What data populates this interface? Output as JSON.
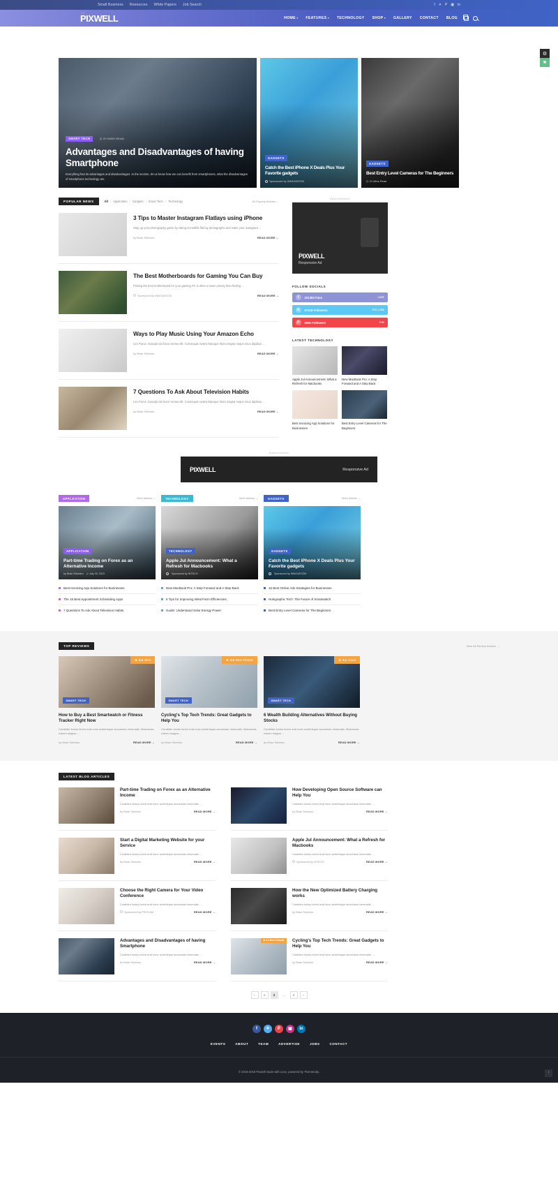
{
  "topbar": {
    "links": [
      "Small Business",
      "Resources",
      "White Papers",
      "Job Search"
    ],
    "social": [
      "f",
      "✈",
      "P",
      "▣",
      "in"
    ]
  },
  "header": {
    "logo": "PIXWELL",
    "nav": [
      {
        "label": "HOME",
        "caret": "▾"
      },
      {
        "label": "FEATURES",
        "caret": "▾"
      },
      {
        "label": "TECHNOLOGY",
        "caret": ""
      },
      {
        "label": "SHOP",
        "caret": "▾"
      },
      {
        "label": "GALLERY",
        "caret": ""
      },
      {
        "label": "CONTACT",
        "caret": ""
      },
      {
        "label": "BLOG",
        "caret": ""
      }
    ]
  },
  "hero": {
    "main": {
      "category": "SMART TECH",
      "meta": "◴ 20 MINS READ",
      "title": "Advantages and Disadvantages of having Smartphone",
      "excerpt": "Everything has its advantages and disadvantages. In the section, let us know how we can benefit from smartphones, what the disadvantages of smartphone technology are."
    },
    "cards": [
      {
        "category": "GADGETS",
        "title": "Catch the Best iPhone X Deals Plus Your Favorite gadgets",
        "meta": "Sponsored by INNOVATION"
      },
      {
        "category": "GADGETS",
        "title": "Best Entry Level Cameras for The Beginners",
        "meta": "◴ 21 Mins Read"
      }
    ]
  },
  "popular": {
    "label": "POPULAR NEWS",
    "tabs": [
      "All",
      "Application",
      "Gadgets",
      "Smart Tech",
      "Technology"
    ],
    "all_link": "All Popular Articles →",
    "posts": [
      {
        "title": "3 Tips to Master Instagram Flatlays using iPhone",
        "excerpt": "Step up your photography game by taking incredible flat lay photographs and make your instagram ...",
        "by": "by Brian Silvestro",
        "readmore": "READ MORE →",
        "img": "img-gray"
      },
      {
        "title": "The Best Motherboards for Gaming You Can Buy",
        "excerpt": "Picking the best motherboard for your gaming PC is often a lower priority than finding ...",
        "by": "Sponsored by INNOVATION",
        "readmore": "READ MORE →",
        "img": "img-board"
      },
      {
        "title": "Ways to Play Music Using Your Amazon Echo",
        "excerpt": "Leo Purus. Suscipit dui fusce metus elit. Consequat nostra Natoque litora magna neque risus dapibus ...",
        "by": "by Brian Silvestro",
        "readmore": "READ MORE →",
        "img": "img-echo"
      },
      {
        "title": "7 Questions To Ask About Television Habits",
        "excerpt": "Leo Purus. Suscipit dui fusce metus elit. Consequat nostra Natoque litora magna neque risus dapibus ...",
        "by": "by Brian Silvestro",
        "readmore": "READ MORE →",
        "img": "img-tv"
      }
    ]
  },
  "sidebar": {
    "ad_label": "- Advertisement -",
    "ad_logo": "PIXWELL",
    "ad_sub": "Responsive Ad",
    "socials_head": "FOLLOW SOCIALS",
    "socials": [
      {
        "icon": "f",
        "count": "221383 Fans",
        "action": "LIKE",
        "cls": "sr-fb"
      },
      {
        "icon": "✈",
        "count": "67418 Followers",
        "action": "FOLLOW",
        "cls": "sr-tw"
      },
      {
        "icon": "P",
        "count": "8655 Followers",
        "action": "PIN",
        "cls": "sr-pin"
      }
    ],
    "tech_head": "LATEST TECHNOLOGY",
    "tech": [
      {
        "title": "Apple Jul Announcement: What a Refresh for Macbooks",
        "img": "img-lap"
      },
      {
        "title": "New MacBook Pro: A Step Forward and A Step Back",
        "img": "img-macbook"
      },
      {
        "title": "Best Invoicing App Solutions for Businesses",
        "img": "img-invoice"
      },
      {
        "title": "Best Entry Level Cameras for The Beginners",
        "img": "img-cam2"
      }
    ]
  },
  "wide_ad": {
    "label": "- Advertisement -",
    "logo": "PIXWELL",
    "sub": "Responsive Ad"
  },
  "categories": [
    {
      "tag": "APPLICATION",
      "tag_cls": "t-app",
      "bullet_cls": "b-app",
      "more": "More Articles →",
      "feature": {
        "badge": "APPLICATION",
        "badge_cls": "cat-purple",
        "title": "Part-time Trading on Forex as an Alternative Income",
        "by": "by Brian Silvestro",
        "date": "◴ July 25, 2019",
        "img": "img-trade"
      },
      "items": [
        "Best Invoicing App Solutions for Businesses",
        "The 15 Best Appointment Scheduling Apps",
        "7 Questions To Ask About Television Habits"
      ]
    },
    {
      "tag": "TECHNOLOGY",
      "tag_cls": "t-tech",
      "bullet_cls": "b-tech",
      "more": "More Articles →",
      "feature": {
        "badge": "TECHNOLOGY",
        "badge_cls": "cat-blue",
        "title": "Apple Jul Announcement: What a Refresh for Macbooks",
        "by": "Sponsored by INTECH",
        "date": "",
        "img": "img-appl"
      },
      "items": [
        "New MacBook Pro: A Step Forward and A Step Back",
        "5 Tips for Improving Wind Farm Efficiencies",
        "Guide: Understand Solar Energy Power"
      ]
    },
    {
      "tag": "GADGETS",
      "tag_cls": "t-gad",
      "bullet_cls": "b-gad",
      "more": "More Articles →",
      "feature": {
        "badge": "GADGETS",
        "badge_cls": "cat-blue",
        "title": "Catch the Best iPhone X Deals Plus Your Favorite gadgets",
        "by": "Sponsored by INNOVATION",
        "date": "",
        "img": "img-phone"
      },
      "items": [
        "16 Best Online Ads Strategies for Businesses",
        "Holographic Tech: The Future of Smartwatch",
        "Best Entry Level Cameras for The Beginners"
      ]
    }
  ],
  "reviews": {
    "label": "TOP REVIEWS",
    "view_all": "View All Review Articles →",
    "cards": [
      {
        "score": "4.6",
        "score_label": "Best",
        "category": "SMART TECH",
        "title": "How to Buy a Best Smartwatch or Fitness Tracker Right Now",
        "excerpt": "Curabitur luctus lorem erat nunc scelerisque accumsan venenatis. Maecenas rutrum magna ...",
        "by": "by Brian Silvestro",
        "readmore": "READ MORE →",
        "img": "img-watch"
      },
      {
        "score": "4.3",
        "score_label": "Best Choose",
        "category": "SMART TECH",
        "title": "Cycling's Top Tech Trends: Great Gadgets to Help You",
        "excerpt": "Curabitur luctus lorem erat nunc scelerisque accumsan venenatis. Maecenas rutrum magna ...",
        "by": "by Brian Silvestro",
        "readmore": "READ MORE →",
        "img": "img-bike"
      },
      {
        "score": "4.1",
        "score_label": "Good",
        "category": "SMART TECH",
        "title": "6 Wealth Building Alternatives Without Buying Stocks",
        "excerpt": "Curabitur luctus lorem erat nunc scelerisque accumsan venenatis. Maecenas rutrum magna ...",
        "by": "by Brian Silvestro",
        "readmore": "READ MORE →",
        "img": "img-stock"
      }
    ]
  },
  "blog": {
    "label": "LATEST BLOG ARTICLES",
    "items": [
      {
        "title": "Part-time Trading on Forex as an Alternative Income",
        "excerpt": "Curabitur luctus lorem erat nunc scelerisque accumsan venenatis. ...",
        "by": "by Brian Silvestro",
        "readmore": "READ MORE →",
        "img": "img-hands",
        "badge": ""
      },
      {
        "title": "How Developing Open Source Software can Help You",
        "excerpt": "Curabitur luctus lorem erat nunc scelerisque accumsan venenatis. ...",
        "by": "by Brian Silvestro",
        "readmore": "READ MORE →",
        "img": "img-code",
        "badge": ""
      },
      {
        "title": "Start a Digital Marketing Website for your Service",
        "excerpt": "Curabitur luctus lorem erat nunc scelerisque accumsan venenatis. ...",
        "by": "by Brian Silvestro",
        "readmore": "READ MORE →",
        "img": "img-digital",
        "badge": ""
      },
      {
        "title": "Apple Jul Announcement: What a Refresh for Macbooks",
        "excerpt": "Curabitur luctus lorem erat nunc scelerisque accumsan venenatis. ...",
        "by": "Sponsored by INTECH",
        "readmore": "READ MORE →",
        "img": "img-macbook2",
        "badge": ""
      },
      {
        "title": "Choose the Right Camera for Your Video Conference",
        "excerpt": "Curabitur luctus lorem erat nunc scelerisque accumsan venenatis. ...",
        "by": "Sponsored by PROCAM",
        "readmore": "READ MORE →",
        "img": "img-office",
        "badge": ""
      },
      {
        "title": "How the New Optimized Battery Charging works",
        "excerpt": "Curabitur luctus lorem erat nunc scelerisque accumsan venenatis. ...",
        "by": "by Brian Silvestro",
        "readmore": "READ MORE →",
        "img": "img-battery",
        "badge": ""
      },
      {
        "title": "Advantages and Disadvantages of having Smartphone",
        "excerpt": "Curabitur luctus lorem erat nunc scelerisque accumsan venenatis. ...",
        "by": "by Brian Silvestro",
        "readmore": "READ MORE →",
        "img": "img-desk",
        "badge": ""
      },
      {
        "title": "Cycling's Top Tech Trends: Great Gadgets to Help You",
        "excerpt": "Curabitur luctus lorem erat nunc scelerisque accumsan venenatis. ...",
        "by": "by Brian Silvestro",
        "readmore": "READ MORE →",
        "img": "img-bike",
        "badge": "★ 4.3 Best Choose"
      }
    ],
    "pager": [
      "‹",
      "1",
      "2",
      "...",
      "4",
      "›"
    ]
  },
  "footer": {
    "social": [
      {
        "glyph": "f",
        "cls": "f-fb"
      },
      {
        "glyph": "✈",
        "cls": "f-tw"
      },
      {
        "glyph": "P",
        "cls": "f-pin"
      },
      {
        "glyph": "▣",
        "cls": "f-ig"
      },
      {
        "glyph": "in",
        "cls": "f-in"
      }
    ],
    "nav": [
      "EVENTS",
      "ABOUT",
      "TEAM",
      "ADVERTISE",
      "JOBS",
      "CONTACT"
    ],
    "copyright": "© 2016-2019 Pixwell made with Love, powered by Themeruby.",
    "to_top": "↑"
  },
  "side_float": {
    "gear": "⚙",
    "lock": "■"
  }
}
